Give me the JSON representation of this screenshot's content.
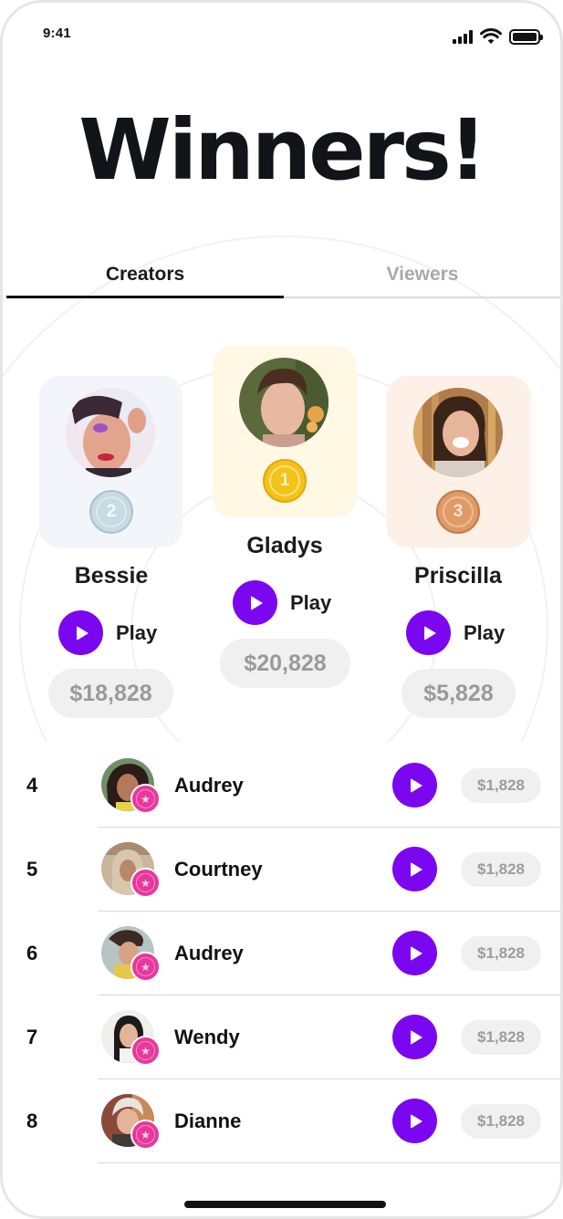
{
  "status": {
    "time": "9:41"
  },
  "title": "Winners!",
  "tabs": [
    {
      "label": "Creators",
      "active": true
    },
    {
      "label": "Viewers",
      "active": false
    }
  ],
  "colors": {
    "accent": "#7b06f0",
    "gold": "#f4c21b",
    "silver": "#b9d2db",
    "bronze": "#de9b68",
    "badge": "#e6399b"
  },
  "podium": [
    {
      "name": "Bessie",
      "place": "2",
      "play_label": "Play",
      "prize": "$18,828",
      "avatar": "avatar-bessie"
    },
    {
      "name": "Gladys",
      "place": "1",
      "play_label": "Play",
      "prize": "$20,828",
      "avatar": "avatar-gladys"
    },
    {
      "name": "Priscilla",
      "place": "3",
      "play_label": "Play",
      "prize": "$5,828",
      "avatar": "avatar-priscilla"
    }
  ],
  "leaderboard": [
    {
      "rank": "4",
      "name": "Audrey",
      "prize": "$1,828"
    },
    {
      "rank": "5",
      "name": "Courtney",
      "prize": "$1,828"
    },
    {
      "rank": "6",
      "name": "Audrey",
      "prize": "$1,828"
    },
    {
      "rank": "7",
      "name": "Wendy",
      "prize": "$1,828"
    },
    {
      "rank": "8",
      "name": "Dianne",
      "prize": "$1,828"
    }
  ]
}
